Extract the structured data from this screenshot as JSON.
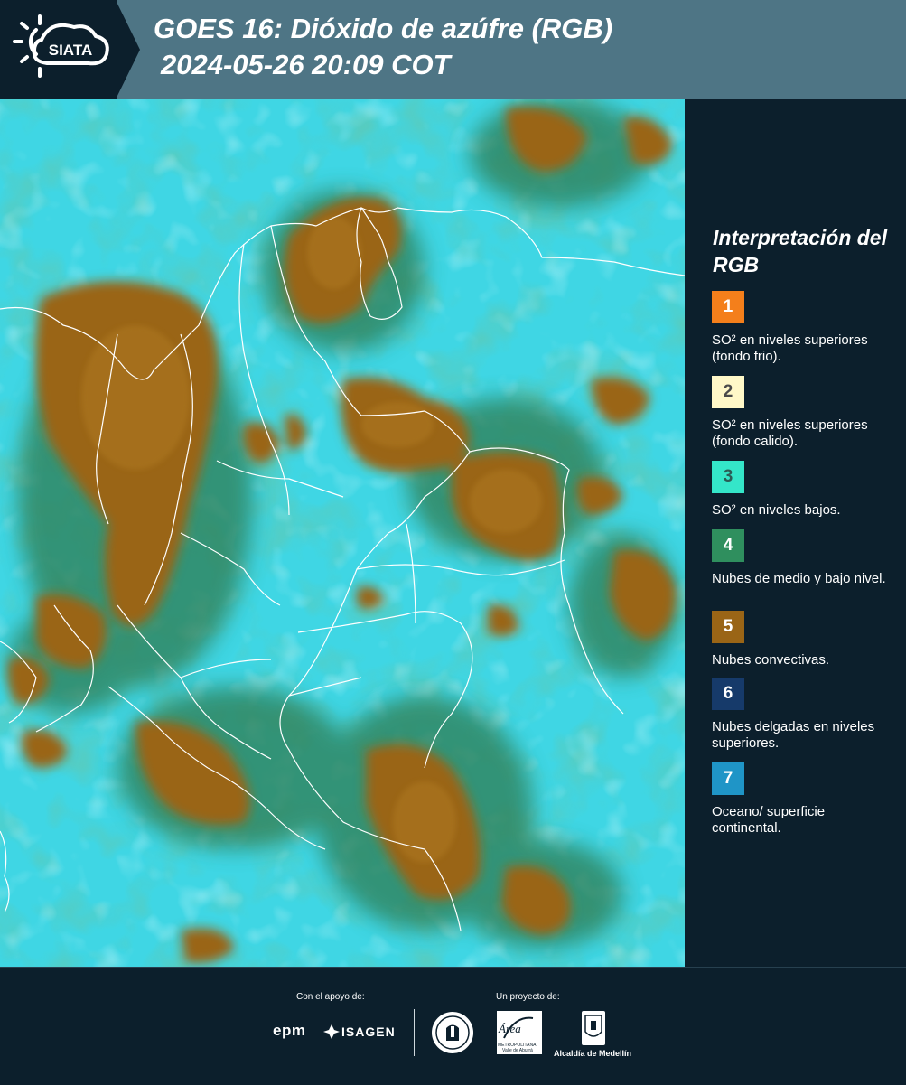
{
  "header": {
    "logo_text": "SIATA",
    "title_line1": "GOES 16: Dióxido de azúfre (RGB)",
    "title_line2": "2024-05-26 20:09 COT"
  },
  "legend": {
    "title": "Interpretación del RGB",
    "items": [
      {
        "number": "1",
        "color": "#f47f1b",
        "number_color": "#ffffff",
        "label": "SO² en niveles superiores (fondo frio)."
      },
      {
        "number": "2",
        "color": "#fff8c8",
        "number_color": "#4a4a4a",
        "label": "SO² en niveles superiores (fondo calido)."
      },
      {
        "number": "3",
        "color": "#34e6c9",
        "number_color": "#2b5b55",
        "label": "SO² en niveles bajos."
      },
      {
        "number": "4",
        "color": "#2f8f5e",
        "number_color": "#ffffff",
        "label": "Nubes de medio y bajo nivel."
      },
      {
        "number": "5",
        "color": "#9a6516",
        "number_color": "#ffffff",
        "label": "Nubes convectivas."
      },
      {
        "number": "6",
        "color": "#163a6a",
        "number_color": "#ffffff",
        "label": "Nubes delgadas en niveles superiores."
      },
      {
        "number": "7",
        "color": "#1f95c7",
        "number_color": "#ffffff",
        "label": "Oceano/ superficie continental."
      }
    ]
  },
  "footer": {
    "support_caption": "Con el apoyo de:",
    "project_caption": "Un proyecto de:",
    "sponsor1": "epm",
    "sponsor2": "ISAGEN",
    "partner_area_name": "Área",
    "partner_area_sub1": "METROPOLITANA",
    "partner_area_sub2": "Valle de Aburrá",
    "partner_alcaldia": "Alcaldía de Medellín"
  },
  "colors": {
    "header_band": "#4e7585",
    "background": "#0c1f2c",
    "ocean_cyan": "#3fd6e4",
    "convective_brown": "#9a6516",
    "mid_green": "#2f8f5e"
  }
}
